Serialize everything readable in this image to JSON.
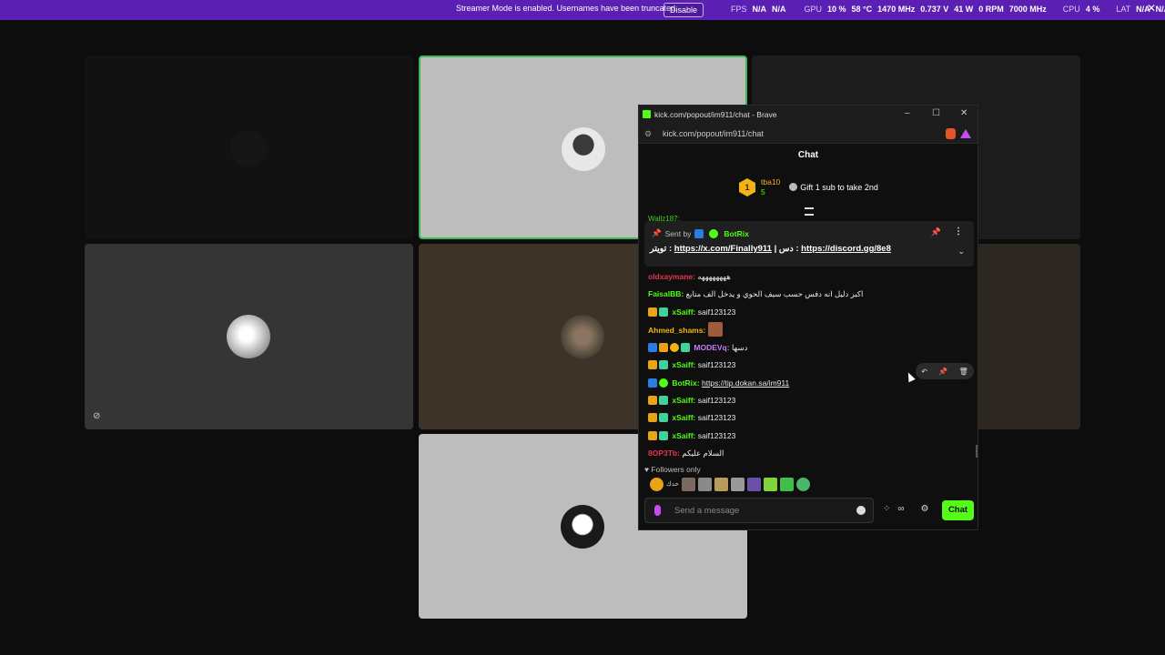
{
  "topbar": {
    "notice": "Streamer Mode is enabled. Usernames have been truncated.",
    "disable_label": "Disable",
    "fps_label": "FPS",
    "fps_value1": "N/A",
    "fps_value2": "N/A",
    "gpu_label": "GPU",
    "gpu_pct": "10 %",
    "gpu_temp": "58 °C",
    "gpu_clock": "1470 MHz",
    "gpu_volt": "0.737 V",
    "gpu_watt": "41 W",
    "gpu_rpm": "0 RPM",
    "gpu_mem": "7000 MHz",
    "cpu_label": "CPU",
    "cpu_pct": "4 %",
    "lat_label": "LAT",
    "lat_value1": "N/A",
    "lat_value2": "N/A"
  },
  "browser": {
    "title": "kick.com/popout/im911/chat - Brave",
    "url": "kick.com/popout/im911/chat"
  },
  "chat": {
    "header": "Chat",
    "leader": {
      "rank": "1",
      "user": "tba10",
      "count": "5",
      "gift_text": "Gift 1 sub to take 2nd"
    },
    "cutoff_user": "Wallz187:",
    "pinned": {
      "sent_by": "Sent by",
      "bot_name": "BotRix",
      "prefix": "تويتر :",
      "link1": "https://x.com/Finally911",
      "sep": "|",
      "mid": "دس :",
      "link2": "https://discord.gg/8e8"
    },
    "messages": [
      {
        "user": "oldxaymane:",
        "text": "ههههههههه"
      },
      {
        "user": "FaisalBB:",
        "text": "اكبر دليل انه دفس حسب سيف الحوي و يدخل الف متابع"
      },
      {
        "user": "xSaiff:",
        "text": "saif123123"
      },
      {
        "user": "Ahmed_shams:",
        "text": ""
      },
      {
        "user": "MODEVq:",
        "text": "دسها"
      },
      {
        "user": "xSaiff:",
        "text": "saif123123"
      },
      {
        "user": "BotRix:",
        "text": "https://tip.dokan.sa/im911"
      },
      {
        "user": "xSaiff:",
        "text": "saif123123"
      },
      {
        "user": "xSaiff:",
        "text": "saif123123"
      },
      {
        "user": "xSaiff:",
        "text": "saif123123"
      },
      {
        "user": "8OP3Tb:",
        "text": "السلام عليكم"
      }
    ],
    "followers_only": "Followers only",
    "input_placeholder": "Send a message",
    "send_label": "Chat",
    "emote_label": "حدك"
  },
  "colors": {
    "accent": "#53fc18",
    "streamer_bar": "#5b1fb3"
  }
}
